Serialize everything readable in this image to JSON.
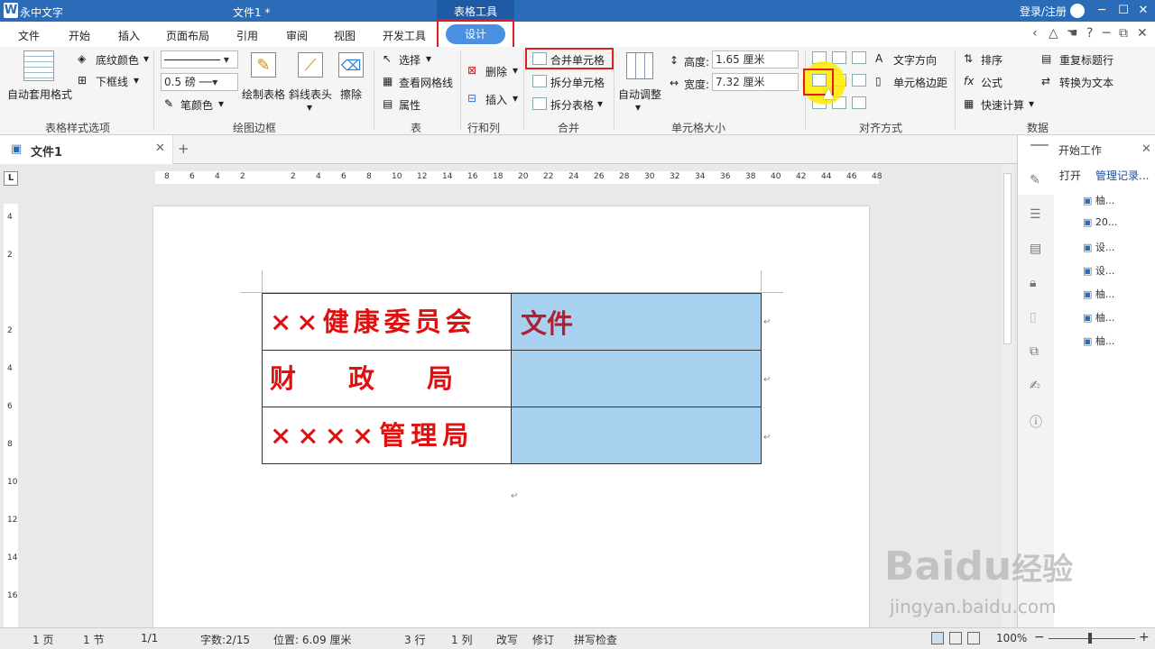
{
  "titlebar": {
    "app": "永中文字",
    "doc": "文件1 *",
    "tool_tab": "表格工具",
    "login": "登录/注册"
  },
  "menu": [
    "文件",
    "开始",
    "插入",
    "页面布局",
    "引用",
    "审阅",
    "视图",
    "开发工具"
  ],
  "design_tab": "设计",
  "ribbon": {
    "auto_format": "自动套用格式",
    "shade": "底纹颜色",
    "bottom_border": "下框线",
    "grp1": "表格样式选项",
    "line_width": "0.5",
    "line_unit": "磅",
    "pen_color": "笔颜色",
    "draw_table": "绘制表格",
    "diag_head": "斜线表头",
    "erase": "擦除",
    "grp2": "绘图边框",
    "select": "选择",
    "view_grid": "查看网格线",
    "props": "属性",
    "grp3": "表",
    "delete": "删除",
    "insert": "插入",
    "grp4": "行和列",
    "merge": "合并单元格",
    "split_cell": "拆分单元格",
    "split_table": "拆分表格",
    "grp5": "合并",
    "auto_adjust": "自动调整",
    "height_label": "高度:",
    "height_val": "1.65 厘米",
    "width_label": "宽度:",
    "width_val": "7.32 厘米",
    "grp6": "单元格大小",
    "text_dir": "文字方向",
    "cell_margin": "单元格边距",
    "grp7": "对齐方式",
    "sort": "排序",
    "formula": "公式",
    "quick_calc": "快速计算",
    "repeat_header": "重复标题行",
    "to_text": "转换为文本",
    "grp8": "数据"
  },
  "doc_tab": "文件1",
  "ruler_numbers": [
    "8",
    "6",
    "4",
    "2",
    "",
    "2",
    "4",
    "6",
    "8",
    "10",
    "12",
    "14",
    "16",
    "18",
    "20",
    "22",
    "24",
    "26",
    "28",
    "30",
    "32",
    "34",
    "36",
    "38",
    "40",
    "42",
    "44",
    "46",
    "48"
  ],
  "vruler_numbers": [
    "4",
    "2",
    "",
    "2",
    "4",
    "6",
    "8",
    "10",
    "12",
    "14",
    "16"
  ],
  "table": [
    {
      "left": "××健康委员会",
      "right": "文件"
    },
    {
      "left": "财　　政　　局",
      "right": ""
    },
    {
      "left": "××××管理局",
      "right": ""
    }
  ],
  "panel": {
    "title": "开始工作",
    "open": "打开",
    "manage": "管理记录...",
    "files": [
      "柚...",
      "20...",
      "设...",
      "设...",
      "柚...",
      "柚...",
      "柚..."
    ]
  },
  "status": {
    "page": "1 页",
    "section": "1 节",
    "pages": "1/1",
    "chars": "字数:2/15",
    "pos": "位置: 6.09 厘米",
    "row": "3 行",
    "col": "1 列",
    "overwrite": "改写",
    "revise": "修订",
    "spell": "拼写检查",
    "zoom": "100%"
  },
  "watermark": {
    "brand": "Baidu",
    "cn": "经验",
    "url": "jingyan.baidu.com"
  },
  "colors": {
    "title_bar": "#2b6cb8",
    "accent": "#4a90e2",
    "highlight": "#e02020",
    "cell_fill": "#a8d0ef",
    "table_text": "#e01010"
  }
}
